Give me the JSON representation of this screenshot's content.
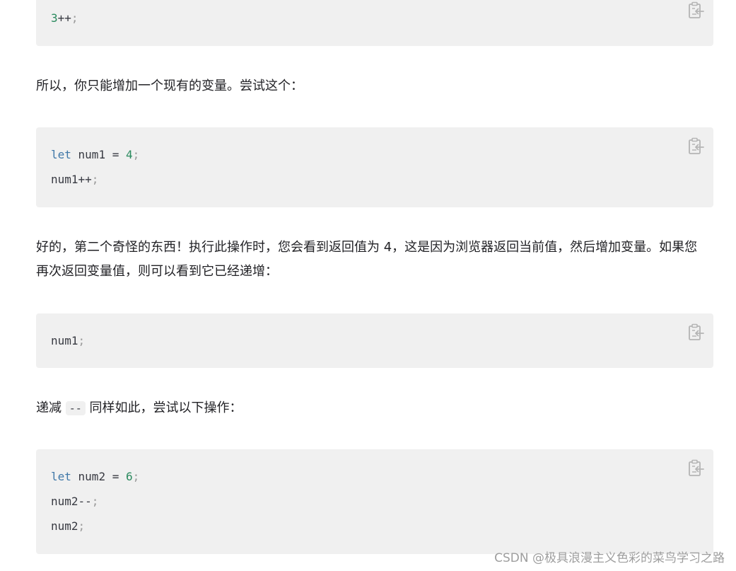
{
  "blocks": {
    "b0": {
      "lines": [
        {
          "num": "3",
          "op": "++",
          "p": ";"
        }
      ]
    },
    "b1": {
      "l1": {
        "kw": "let",
        "ident": " num1 = ",
        "num": "4",
        "p": ";"
      },
      "l2": {
        "text": "num1++",
        "p": ";"
      }
    },
    "b2": {
      "l1": {
        "text": "num1",
        "p": ";"
      }
    },
    "b3": {
      "l1": {
        "kw": "let",
        "ident": " num2 = ",
        "num": "6",
        "p": ";"
      },
      "l2": {
        "text": "num2--",
        "p": ";"
      },
      "l3": {
        "text": "num2",
        "p": ";"
      }
    }
  },
  "paragraphs": {
    "p1": "所以，你只能增加一个现有的变量。尝试这个：",
    "p2": "好的，第二个奇怪的东西！执行此操作时，您会看到返回值为 4，这是因为浏览器返回当前值，然后增加变量。如果您再次返回变量值，则可以看到它已经递增：",
    "p3_before": "递减 ",
    "p3_code": "--",
    "p3_after": " 同样如此，尝试以下操作："
  },
  "watermark": "CSDN @极具浪漫主义色彩的菜鸟学习之路",
  "icons": {
    "copy": "copy-icon"
  }
}
